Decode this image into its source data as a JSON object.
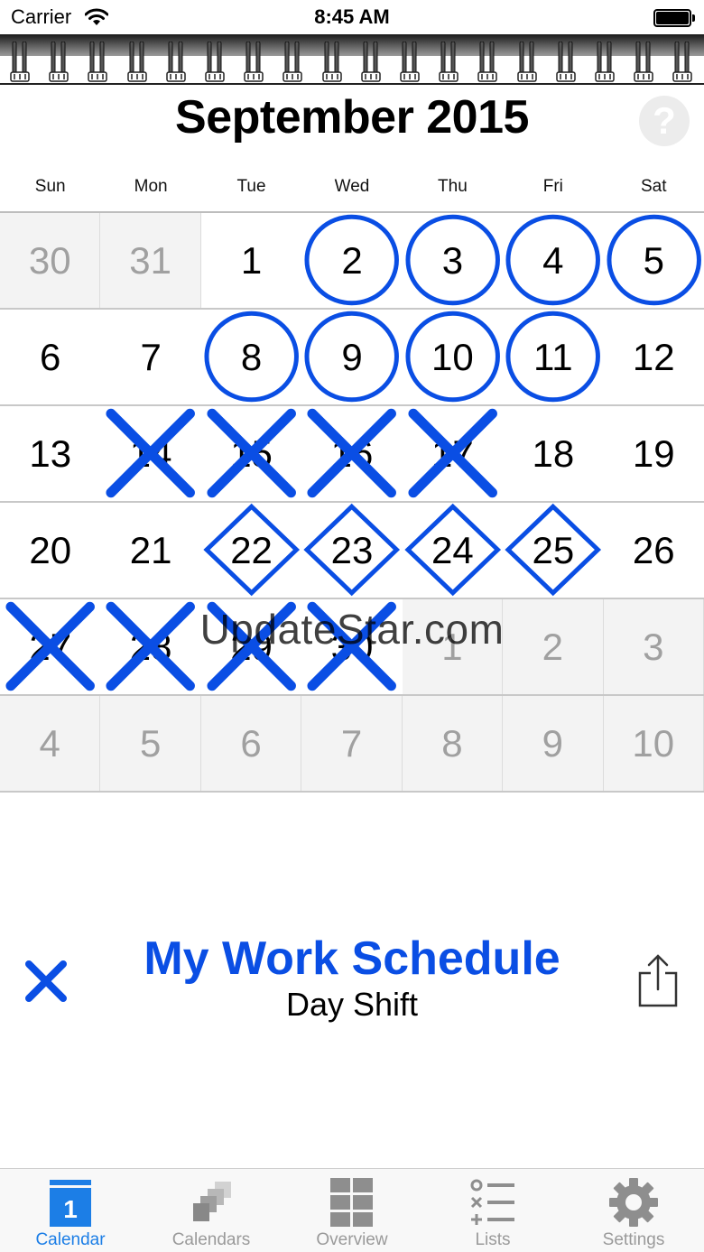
{
  "status_bar": {
    "carrier": "Carrier",
    "time": "8:45 AM"
  },
  "calendar": {
    "title": "September 2015",
    "help_label": "?",
    "weekdays": [
      "Sun",
      "Mon",
      "Tue",
      "Wed",
      "Thu",
      "Fri",
      "Sat"
    ],
    "weeks": [
      [
        {
          "day": "30",
          "other": true,
          "mark": ""
        },
        {
          "day": "31",
          "other": true,
          "mark": ""
        },
        {
          "day": "1",
          "other": false,
          "mark": ""
        },
        {
          "day": "2",
          "other": false,
          "mark": "circle"
        },
        {
          "day": "3",
          "other": false,
          "mark": "circle"
        },
        {
          "day": "4",
          "other": false,
          "mark": "circle"
        },
        {
          "day": "5",
          "other": false,
          "mark": "circle"
        }
      ],
      [
        {
          "day": "6",
          "other": false,
          "mark": ""
        },
        {
          "day": "7",
          "other": false,
          "mark": ""
        },
        {
          "day": "8",
          "other": false,
          "mark": "circle"
        },
        {
          "day": "9",
          "other": false,
          "mark": "circle"
        },
        {
          "day": "10",
          "other": false,
          "mark": "circle"
        },
        {
          "day": "11",
          "other": false,
          "mark": "circle"
        },
        {
          "day": "12",
          "other": false,
          "mark": ""
        }
      ],
      [
        {
          "day": "13",
          "other": false,
          "mark": ""
        },
        {
          "day": "14",
          "other": false,
          "mark": "cross"
        },
        {
          "day": "15",
          "other": false,
          "mark": "cross"
        },
        {
          "day": "16",
          "other": false,
          "mark": "cross"
        },
        {
          "day": "17",
          "other": false,
          "mark": "cross"
        },
        {
          "day": "18",
          "other": false,
          "mark": ""
        },
        {
          "day": "19",
          "other": false,
          "mark": ""
        }
      ],
      [
        {
          "day": "20",
          "other": false,
          "mark": ""
        },
        {
          "day": "21",
          "other": false,
          "mark": ""
        },
        {
          "day": "22",
          "other": false,
          "mark": "diamond"
        },
        {
          "day": "23",
          "other": false,
          "mark": "diamond"
        },
        {
          "day": "24",
          "other": false,
          "mark": "diamond"
        },
        {
          "day": "25",
          "other": false,
          "mark": "diamond"
        },
        {
          "day": "26",
          "other": false,
          "mark": ""
        }
      ],
      [
        {
          "day": "27",
          "other": false,
          "mark": "cross"
        },
        {
          "day": "28",
          "other": false,
          "mark": "cross"
        },
        {
          "day": "29",
          "other": false,
          "mark": "cross"
        },
        {
          "day": "30",
          "other": false,
          "mark": "cross"
        },
        {
          "day": "1",
          "other": true,
          "mark": ""
        },
        {
          "day": "2",
          "other": true,
          "mark": ""
        },
        {
          "day": "3",
          "other": true,
          "mark": ""
        }
      ],
      [
        {
          "day": "4",
          "other": true,
          "mark": ""
        },
        {
          "day": "5",
          "other": true,
          "mark": ""
        },
        {
          "day": "6",
          "other": true,
          "mark": ""
        },
        {
          "day": "7",
          "other": true,
          "mark": ""
        },
        {
          "day": "8",
          "other": true,
          "mark": ""
        },
        {
          "day": "9",
          "other": true,
          "mark": ""
        },
        {
          "day": "10",
          "other": true,
          "mark": ""
        }
      ]
    ],
    "mark_color": "#0a4ee4",
    "watermark": "UpdateStar.com"
  },
  "schedule": {
    "title": "My Work Schedule",
    "subtitle": "Day Shift",
    "accent": "#0a4ee4",
    "close_icon": "close-icon",
    "share_icon": "share-icon"
  },
  "tab_bar": {
    "active_color": "#1c7ee6",
    "inactive_color": "#9a9a9a",
    "calendar_icon_number": "1",
    "tabs": [
      {
        "label": "Calendar",
        "icon": "calendar-icon",
        "active": true
      },
      {
        "label": "Calendars",
        "icon": "calendars-stack-icon",
        "active": false
      },
      {
        "label": "Overview",
        "icon": "overview-grid-icon",
        "active": false
      },
      {
        "label": "Lists",
        "icon": "list-icon",
        "active": false
      },
      {
        "label": "Settings",
        "icon": "gear-icon",
        "active": false
      }
    ]
  }
}
